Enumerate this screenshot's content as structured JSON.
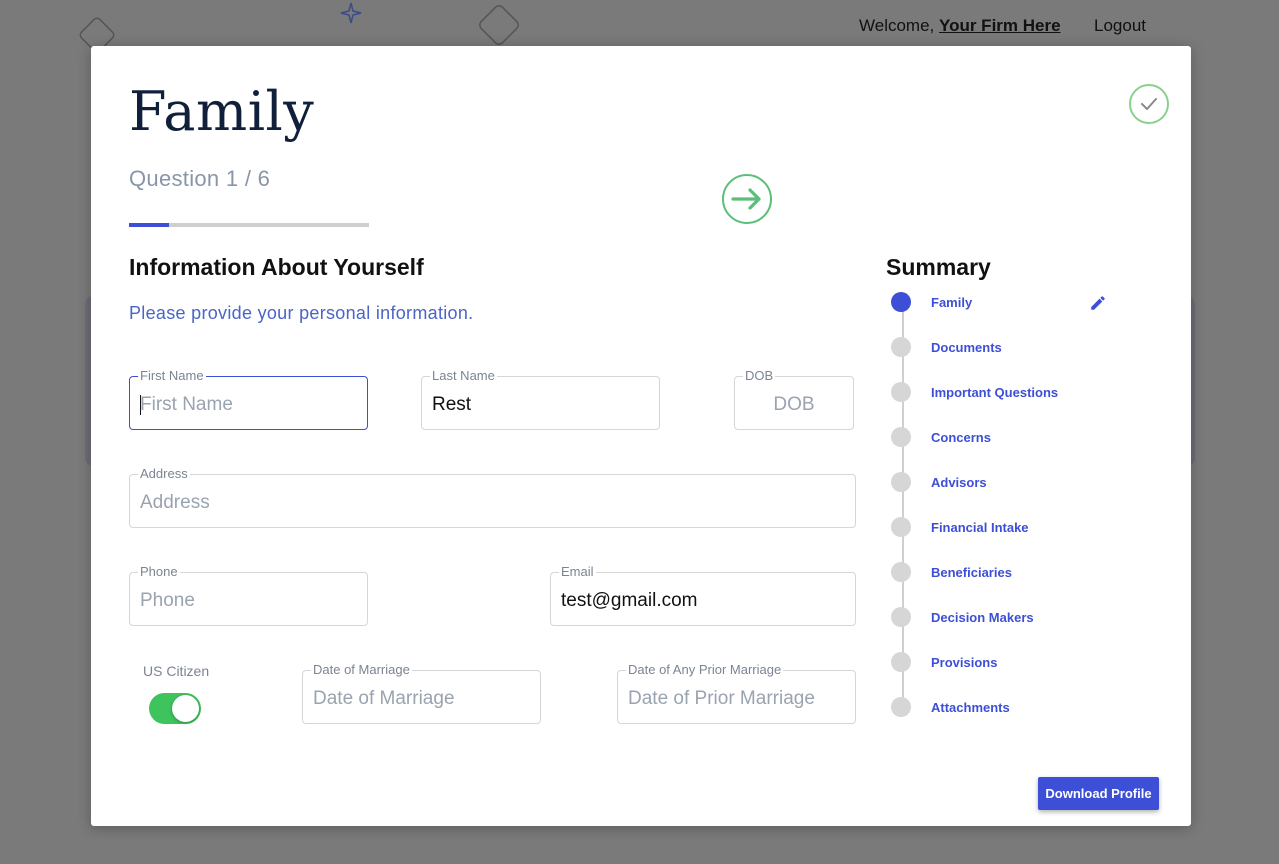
{
  "header": {
    "welcome_prefix": "Welcome, ",
    "firm_name": "Your Firm Here",
    "logout_label": "Logout"
  },
  "modal": {
    "title": "Family",
    "question_counter": "Question 1 / 6",
    "progress": 0.1667,
    "section_title": "Information About Yourself",
    "section_subtitle": "Please provide your personal information."
  },
  "form": {
    "first_name": {
      "label": "First Name",
      "placeholder": "First Name",
      "value": ""
    },
    "last_name": {
      "label": "Last Name",
      "placeholder": "Last Name",
      "value": "Rest"
    },
    "dob": {
      "label": "DOB",
      "placeholder": "DOB",
      "value": ""
    },
    "address": {
      "label": "Address",
      "placeholder": "Address",
      "value": ""
    },
    "phone": {
      "label": "Phone",
      "placeholder": "Phone",
      "value": ""
    },
    "email": {
      "label": "Email",
      "placeholder": "Email",
      "value": "test@gmail.com"
    },
    "us_citizen": {
      "label": "US Citizen",
      "checked": true
    },
    "date_of_marriage": {
      "label": "Date of Marriage",
      "placeholder": "Date of Marriage",
      "value": ""
    },
    "prior_marriage": {
      "label": "Date of Any Prior Marriage",
      "placeholder": "Date of Prior Marriage",
      "value": ""
    }
  },
  "summary": {
    "title": "Summary",
    "steps": [
      {
        "label": "Family",
        "active": true
      },
      {
        "label": "Documents",
        "active": false
      },
      {
        "label": "Important Questions",
        "active": false
      },
      {
        "label": "Concerns",
        "active": false
      },
      {
        "label": "Advisors",
        "active": false
      },
      {
        "label": "Financial Intake",
        "active": false
      },
      {
        "label": "Beneficiaries",
        "active": false
      },
      {
        "label": "Decision Makers",
        "active": false
      },
      {
        "label": "Provisions",
        "active": false
      },
      {
        "label": "Attachments",
        "active": false
      }
    ]
  },
  "actions": {
    "download_label": "Download Profile"
  },
  "icons": {
    "complete": "check-circle-icon",
    "next": "arrow-right-circle-icon",
    "edit": "pencil-icon"
  },
  "colors": {
    "accent": "#3d4fd6",
    "success": "#5bbf7a",
    "toggle_on": "#3fc35c",
    "title": "#10203a"
  }
}
